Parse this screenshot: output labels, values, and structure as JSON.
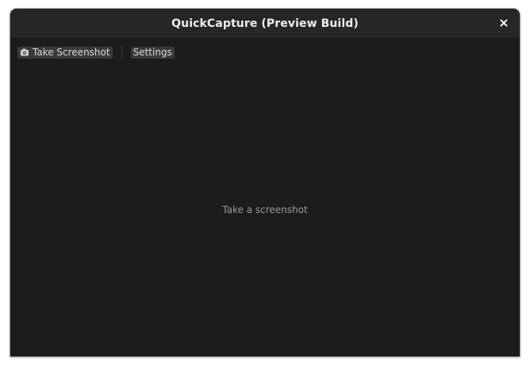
{
  "window": {
    "title": "QuickCapture (Preview Build)",
    "close_icon": "close-icon"
  },
  "toolbar": {
    "take_screenshot_label": "Take Screenshot",
    "take_screenshot_icon": "camera-icon",
    "settings_label": "Settings"
  },
  "main": {
    "placeholder_text": "Take a screenshot"
  },
  "colors": {
    "window_bg": "#1c1c1c",
    "titlebar_bg": "#262626",
    "button_bg": "#3a3a3a",
    "title_text": "#eeeeee",
    "placeholder_text": "#9a9a9a"
  }
}
